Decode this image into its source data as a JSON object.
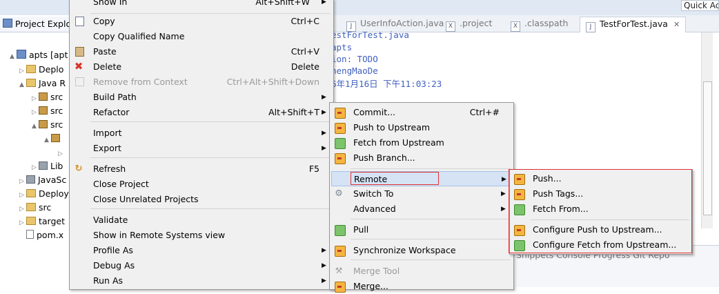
{
  "quick_access": "Quick Ac",
  "explorer": {
    "tab_label": "Project Explo",
    "items": [
      {
        "label": "apts  [apt",
        "toggle": "▲"
      },
      {
        "label": "Deplo",
        "toggle": "▷"
      },
      {
        "label": "Java R",
        "toggle": "▲"
      },
      {
        "label": "src",
        "toggle": "▷"
      },
      {
        "label": "src",
        "toggle": "▷"
      },
      {
        "label": "src",
        "toggle": "▲"
      },
      {
        "label": "",
        "toggle": "▲"
      },
      {
        "label": "",
        "toggle": "▷"
      },
      {
        "label": "Lib",
        "toggle": "▷"
      },
      {
        "label": "JavaSc",
        "toggle": "▷"
      },
      {
        "label": "Deploy",
        "toggle": "▷"
      },
      {
        "label": "src",
        "toggle": "▷"
      },
      {
        "label": "target",
        "toggle": "▷"
      },
      {
        "label": "pom.x",
        "toggle": ""
      }
    ]
  },
  "editor_tabs": [
    {
      "label": "UserInfoAction.java",
      "icon": "J"
    },
    {
      "label": ".project",
      "icon": "X"
    },
    {
      "label": ".classpath",
      "icon": "X"
    },
    {
      "label": "TestForTest.java",
      "icon": "J",
      "active": true
    }
  ],
  "editor_lines": [
    "estForTest.java",
    "apts",
    "ion: TODO",
    "hengMaoDe",
    "6年1月16日 下午11:03:23"
  ],
  "bottom_tabs": "Snippets   Console   Progress   Git Repo",
  "context_menu": {
    "items": [
      {
        "label": "Show In",
        "shortcut": "Alt+Shift+W",
        "arrow": "▶",
        "icon": ""
      },
      {
        "label": "Copy",
        "shortcut": "Ctrl+C",
        "icon": "copy-icon"
      },
      {
        "label": "Copy Qualified Name",
        "shortcut": "",
        "icon": ""
      },
      {
        "label": "Paste",
        "shortcut": "Ctrl+V",
        "icon": "paste-icon"
      },
      {
        "label": "Delete",
        "shortcut": "Delete",
        "icon": "delete-icon"
      },
      {
        "label": "Remove from Context",
        "shortcut": "Ctrl+Alt+Shift+Down",
        "icon": "remove-context-icon",
        "disabled": true
      },
      {
        "label": "Build Path",
        "shortcut": "",
        "arrow": "▶"
      },
      {
        "label": "Refactor",
        "shortcut": "Alt+Shift+T",
        "arrow": "▶"
      },
      {
        "label": "Import",
        "shortcut": "",
        "arrow": "▶",
        "icon": "import-icon"
      },
      {
        "label": "Export",
        "shortcut": "",
        "arrow": "▶",
        "icon": "export-icon"
      },
      {
        "label": "Refresh",
        "shortcut": "F5",
        "icon": "refresh-icon"
      },
      {
        "label": "Close Project",
        "shortcut": ""
      },
      {
        "label": "Close Unrelated Projects",
        "shortcut": ""
      },
      {
        "label": "Validate",
        "shortcut": ""
      },
      {
        "label": "Show in Remote Systems view",
        "shortcut": ""
      },
      {
        "label": "Profile As",
        "shortcut": "",
        "arrow": "▶"
      },
      {
        "label": "Debug As",
        "shortcut": "",
        "arrow": "▶"
      },
      {
        "label": "Run As",
        "shortcut": "",
        "arrow": "▶"
      }
    ]
  },
  "team_menu": {
    "items": [
      {
        "label": "Commit...",
        "shortcut": "Ctrl+#",
        "icon": "commit-icon"
      },
      {
        "label": "Push to Upstream",
        "shortcut": "",
        "icon": "push-upstream-icon"
      },
      {
        "label": "Fetch from Upstream",
        "shortcut": "",
        "icon": "fetch-upstream-icon"
      },
      {
        "label": "Push Branch...",
        "shortcut": "",
        "icon": "push-branch-icon"
      },
      {
        "label": "Remote",
        "shortcut": "",
        "arrow": "▶",
        "highlighted": true
      },
      {
        "label": "Switch To",
        "shortcut": "",
        "arrow": "▶",
        "icon": "switch-icon"
      },
      {
        "label": "Advanced",
        "shortcut": "",
        "arrow": "▶"
      },
      {
        "label": "Pull",
        "shortcut": "",
        "icon": "pull-icon"
      },
      {
        "label": "Synchronize Workspace",
        "shortcut": "",
        "icon": "synchronize-icon"
      },
      {
        "label": "Merge Tool",
        "shortcut": "",
        "icon": "merge-tool-icon",
        "disabled": true
      },
      {
        "label": "Merge...",
        "shortcut": "",
        "icon": "merge-icon"
      }
    ]
  },
  "remote_menu": {
    "items": [
      {
        "label": "Push...",
        "icon": "push-icon"
      },
      {
        "label": "Push Tags...",
        "icon": "push-tags-icon"
      },
      {
        "label": "Fetch From...",
        "icon": "fetch-icon"
      },
      {
        "label": "Configure Push to Upstream...",
        "icon": "configure-push-icon"
      },
      {
        "label": "Configure Fetch from Upstream...",
        "icon": "configure-fetch-icon"
      }
    ]
  },
  "colors": {
    "highlight_border": "#e03030",
    "menu_background": "#f0f0f0",
    "javadoc_text": "#3f5fbf"
  }
}
